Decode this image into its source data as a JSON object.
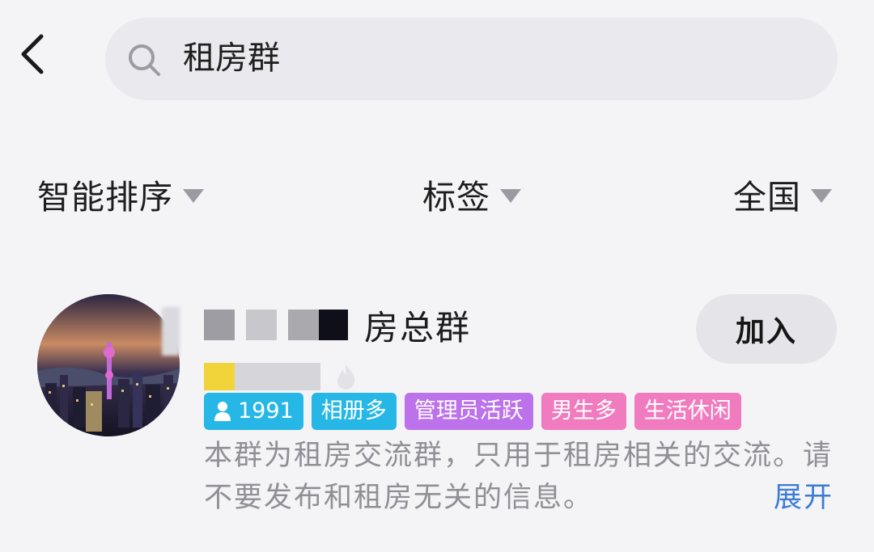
{
  "search": {
    "query": "租房群"
  },
  "filters": [
    {
      "label": "智能排序"
    },
    {
      "label": "标签"
    },
    {
      "label": "全国"
    }
  ],
  "result": {
    "name_suffix": "房总群",
    "join_label": "加入",
    "tags": {
      "members": "1991",
      "album": "相册多",
      "admin": "管理员活跃",
      "gender": "男生多",
      "category": "生活休闲"
    },
    "description": "本群为租房交流群，只用于租房相关的交流。请不要发布和租房无关的信息。",
    "expand_label": "展开"
  },
  "colors": {
    "tag_blue": "#27b7e6",
    "tag_purple": "#bb72ea",
    "tag_pink": "#f07cbf",
    "link_blue": "#3a7bd6"
  },
  "icons": {
    "back": "chevron-left-icon",
    "search": "search-icon",
    "dropdown": "triangle-down-icon",
    "members": "person-icon",
    "hot": "fire-icon"
  }
}
